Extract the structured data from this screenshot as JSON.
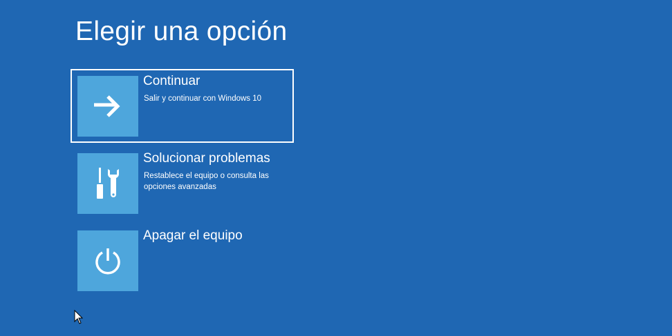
{
  "title": "Elegir una opción",
  "options": [
    {
      "title": "Continuar",
      "description": "Salir y continuar con Windows 10",
      "icon": "arrow-right-icon",
      "selected": true
    },
    {
      "title": "Solucionar problemas",
      "description": "Restablece el equipo o consulta las opciones avanzadas",
      "icon": "tools-icon",
      "selected": false
    },
    {
      "title": "Apagar el equipo",
      "description": "",
      "icon": "power-icon",
      "selected": false
    }
  ],
  "colors": {
    "background": "#1f67b3",
    "tile": "#4ea6dc",
    "selection_border": "#ffffff"
  }
}
